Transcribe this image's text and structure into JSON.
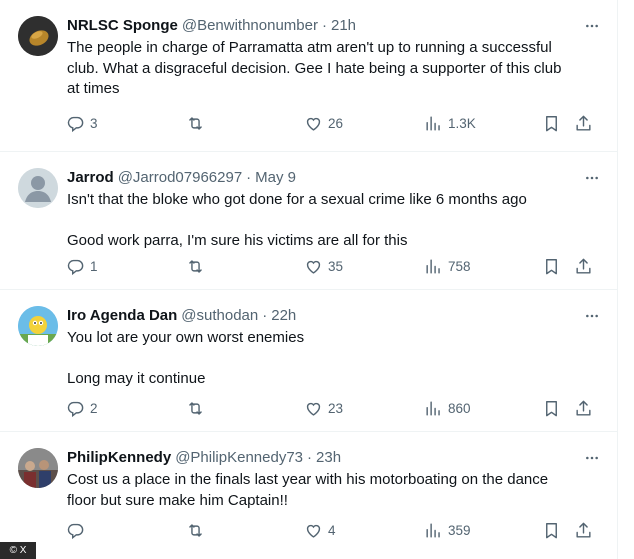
{
  "tweets": [
    {
      "name": "NRLSC Sponge",
      "handle": "@Benwithnonumber",
      "time": "21h",
      "lines": [
        "The people in charge of Parramatta atm aren't up to running a successful",
        "club. What a disgraceful decision. Gee I hate being a supporter of this club",
        "at times"
      ],
      "replies": "3",
      "retweets": "",
      "likes": "26",
      "views": "1.3K"
    },
    {
      "name": "Jarrod",
      "handle": "@Jarrod07966297",
      "time": "May 9",
      "line1": "Isn't that the bloke who got done for a sexual crime like 6 months ago",
      "line2": "Good work parra, I'm sure his victims are all for this",
      "replies": "1",
      "retweets": "",
      "likes": "35",
      "views": "758"
    },
    {
      "name": "Iro Agenda Dan",
      "handle": "@suthodan",
      "time": "22h",
      "line1": "You lot are your own worst enemies",
      "line2": "Long may it continue",
      "replies": "2",
      "retweets": "",
      "likes": "23",
      "views": "860"
    },
    {
      "name": "PhilipKennedy",
      "handle": "@PhilipKennedy73",
      "time": "23h",
      "lines": [
        "Cost us a place in the finals last year with his motorboating on the dance",
        "floor but sure make him Captain!!"
      ],
      "replies": "",
      "retweets": "",
      "likes": "4",
      "views": "359"
    }
  ],
  "separator": "·",
  "badge": "© X",
  "colors": {
    "text": "#0f1419",
    "muted": "#536471",
    "divider": "#eff3f4"
  },
  "icons": [
    "more-icon",
    "reply-icon",
    "retweet-icon",
    "like-icon",
    "views-icon",
    "bookmark-icon",
    "share-icon"
  ]
}
